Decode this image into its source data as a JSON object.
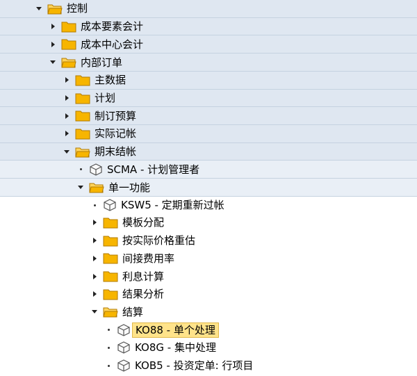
{
  "tree": [
    {
      "level": 0,
      "type": "folder",
      "expander": "down",
      "label": "控制"
    },
    {
      "level": 1,
      "type": "folder",
      "expander": "right",
      "label": "成本要素会计"
    },
    {
      "level": 1,
      "type": "folder",
      "expander": "right",
      "label": "成本中心会计"
    },
    {
      "level": 1,
      "type": "folder",
      "expander": "down",
      "label": "内部订单"
    },
    {
      "level": 2,
      "type": "folder",
      "expander": "right",
      "label": "主数据"
    },
    {
      "level": 2,
      "type": "folder",
      "expander": "right",
      "label": "计划"
    },
    {
      "level": 2,
      "type": "folder",
      "expander": "right",
      "label": "制订预算"
    },
    {
      "level": 2,
      "type": "folder",
      "expander": "right",
      "label": "实际记帐"
    },
    {
      "level": 2,
      "type": "folder",
      "expander": "down",
      "label": "期末结帐"
    },
    {
      "level": 3,
      "type": "transaction",
      "expander": "dot",
      "label": "SCMA - 计划管理者"
    },
    {
      "level": 3,
      "type": "folder",
      "expander": "down",
      "label": "单一功能"
    },
    {
      "level": 4,
      "type": "transaction",
      "expander": "dot",
      "label": "KSW5 - 定期重新过帐"
    },
    {
      "level": 4,
      "type": "folder",
      "expander": "right",
      "label": "模板分配"
    },
    {
      "level": 4,
      "type": "folder",
      "expander": "right",
      "label": "按实际价格重估"
    },
    {
      "level": 4,
      "type": "folder",
      "expander": "right",
      "label": "间接费用率"
    },
    {
      "level": 4,
      "type": "folder",
      "expander": "right",
      "label": "利息计算"
    },
    {
      "level": 4,
      "type": "folder",
      "expander": "right",
      "label": "结果分析"
    },
    {
      "level": 4,
      "type": "folder",
      "expander": "down",
      "label": "结算"
    },
    {
      "level": 5,
      "type": "transaction",
      "expander": "dot",
      "label": "KO88 - 单个处理",
      "selected": true
    },
    {
      "level": 5,
      "type": "transaction",
      "expander": "dot",
      "label": "KO8G - 集中处理"
    },
    {
      "level": 5,
      "type": "transaction",
      "expander": "dot",
      "label": "KOB5 - 投资定单: 行项目"
    }
  ],
  "colors": {
    "folder": "#f7b500",
    "folder_edge": "#b07a00",
    "row_shade": "#dfe7f1",
    "selection": "#ffe38a"
  },
  "icons": {
    "folder": "folder-icon",
    "open_folder": "folder-open-icon",
    "transaction": "transaction-cube-icon"
  }
}
